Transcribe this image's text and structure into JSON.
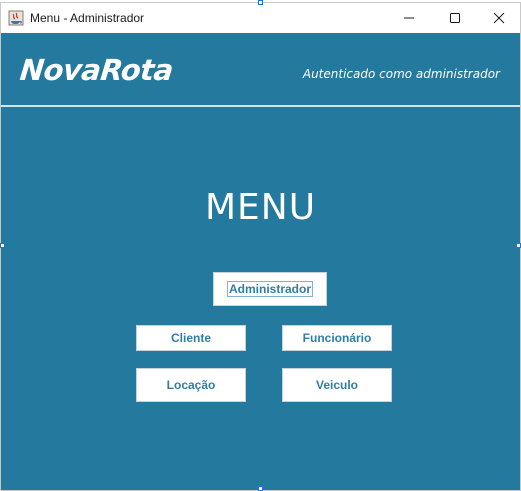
{
  "window": {
    "title": "Menu - Administrador",
    "controls": {
      "minimize": "minimize-icon",
      "maximize": "maximize-icon",
      "close": "close-icon"
    }
  },
  "header": {
    "logo": "NovaRota",
    "auth_status": "Autenticado como administrador"
  },
  "main": {
    "title": "MENU",
    "buttons": {
      "administrador": "Administrador",
      "cliente": "Cliente",
      "funcionario": "Funcionário",
      "locacao": "Locação",
      "veiculo": "Veiculo"
    }
  },
  "colors": {
    "background": "#23799e",
    "button_text": "#2f7ea6",
    "text_light": "#ffffff"
  }
}
